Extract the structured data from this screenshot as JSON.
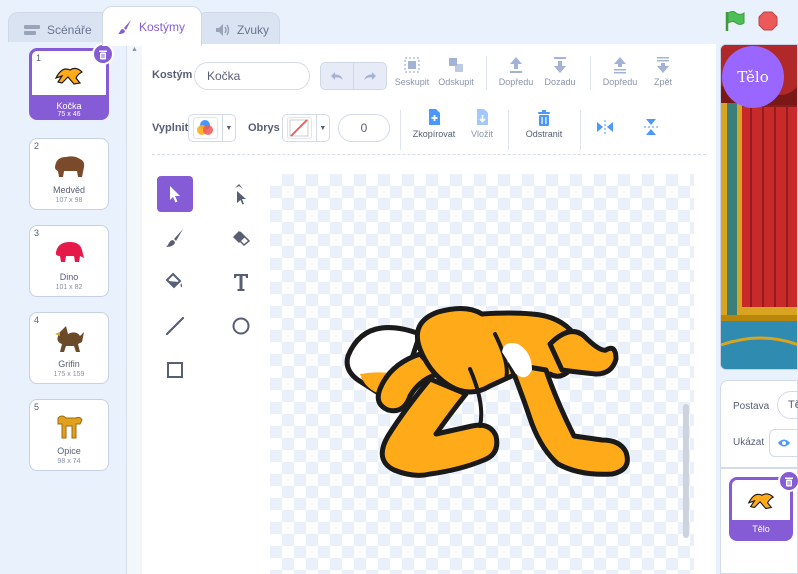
{
  "tabs": [
    {
      "label": "Scénáře",
      "icon": "code-icon",
      "active": false
    },
    {
      "label": "Kostýmy",
      "icon": "brush-icon",
      "active": true
    },
    {
      "label": "Zvuky",
      "icon": "speaker-icon",
      "active": false
    }
  ],
  "costumes": [
    {
      "number": "1",
      "name": "Kočka",
      "size": "75 x 46",
      "selected": true,
      "icon": "cat-running-icon"
    },
    {
      "number": "2",
      "name": "Medvěd",
      "size": "107 x 98",
      "selected": false,
      "icon": "bear-icon"
    },
    {
      "number": "3",
      "name": "Dino",
      "size": "101 x 82",
      "selected": false,
      "icon": "dino-icon"
    },
    {
      "number": "4",
      "name": "Grifin",
      "size": "175 x 159",
      "selected": false,
      "icon": "griffin-icon"
    },
    {
      "number": "5",
      "name": "Opice",
      "size": "98 x 74",
      "selected": false,
      "icon": "monkey-icon"
    }
  ],
  "editor": {
    "costume_label": "Kostým",
    "costume_name": "Kočka",
    "fill_label": "Vyplnit",
    "outline_label": "Obrys",
    "outline_width": "0",
    "group_label": "Seskupit",
    "ungroup_label": "Odskupit",
    "forward_label": "Dopředu",
    "backward_label": "Dozadu",
    "front_label": "Dopředu",
    "back_label": "Zpět",
    "copy_label": "Zkopírovat",
    "paste_label": "Vložit",
    "delete_label": "Odstranit"
  },
  "sprite_info": {
    "sprite_label": "Postava",
    "sprite_name": "Tělo",
    "show_label": "Ukázat"
  },
  "sprite_list": [
    {
      "name": "Tělo",
      "selected": true
    }
  ],
  "stage_badge": "Tělo",
  "colors": {
    "accent": "#855cd6",
    "cat_orange": "#ffab19",
    "stop_red": "#ec5959",
    "go_green": "#4cbf56"
  }
}
